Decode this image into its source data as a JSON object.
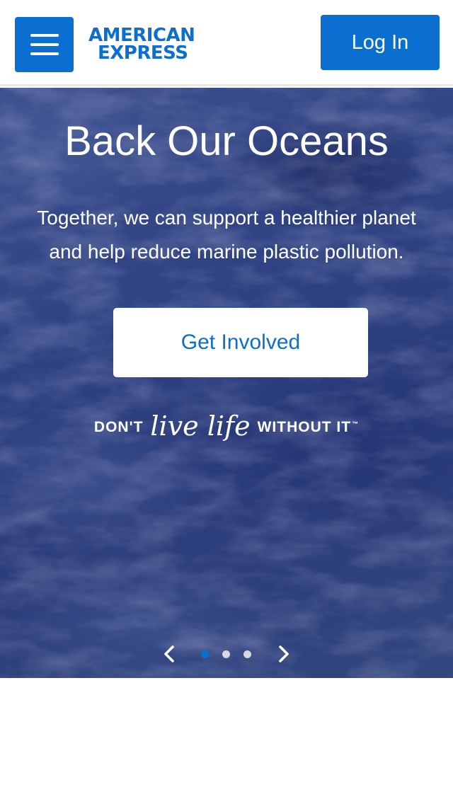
{
  "header": {
    "menu_icon": "hamburger-menu-icon",
    "logo_line1": "AMERICAN",
    "logo_line2": "EXPRESS",
    "login_label": "Log In"
  },
  "hero": {
    "title": "Back Our Oceans",
    "subtitle_line1": "Together, we can support a healthier planet",
    "subtitle_line2": "and help reduce marine plastic pollution.",
    "cta_label": "Get Involved",
    "tagline": {
      "dont": "DON'T",
      "live_life": "live life",
      "without_it": "WITHOUT IT",
      "tm": "™"
    }
  },
  "carousel": {
    "prev_icon": "chevron-left-icon",
    "next_icon": "chevron-right-icon",
    "slide_count": 3,
    "active_slide": 1
  },
  "colors": {
    "brand_blue": "#0a6fd1",
    "hero_bg": "#2f4283",
    "dot_inactive": "#d6d9e2"
  }
}
